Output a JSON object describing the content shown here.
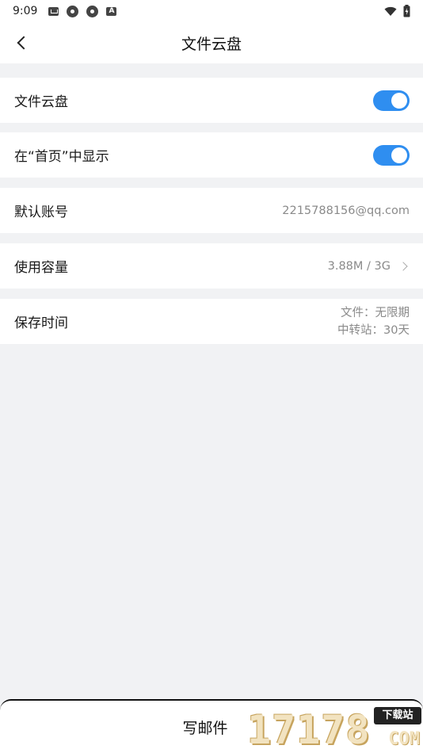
{
  "status_bar": {
    "time": "9:09",
    "icons": [
      "mail-icon",
      "app-icon",
      "app-icon",
      "a-icon"
    ],
    "right_icons": [
      "wifi-icon",
      "battery-icon"
    ]
  },
  "nav": {
    "title": "文件云盘",
    "back_icon": "chevron-left-icon"
  },
  "settings": {
    "cloud_drive": {
      "label": "文件云盘",
      "enabled": true
    },
    "show_on_home": {
      "label": "在“首页”中显示",
      "enabled": true
    },
    "default_account": {
      "label": "默认账号",
      "value": "2215788156@qq.com"
    },
    "usage": {
      "label": "使用容量",
      "value": "3.88M / 3G"
    },
    "retention": {
      "label": "保存时间",
      "files": "文件：无限期",
      "transfer": "中转站：30天"
    }
  },
  "compose": {
    "label": "写邮件"
  },
  "watermark": {
    "digits": "17178",
    "tag": "下载站",
    "domain": "COM"
  },
  "colors": {
    "accent": "#2f8ef0",
    "background": "#f1f2f4"
  }
}
